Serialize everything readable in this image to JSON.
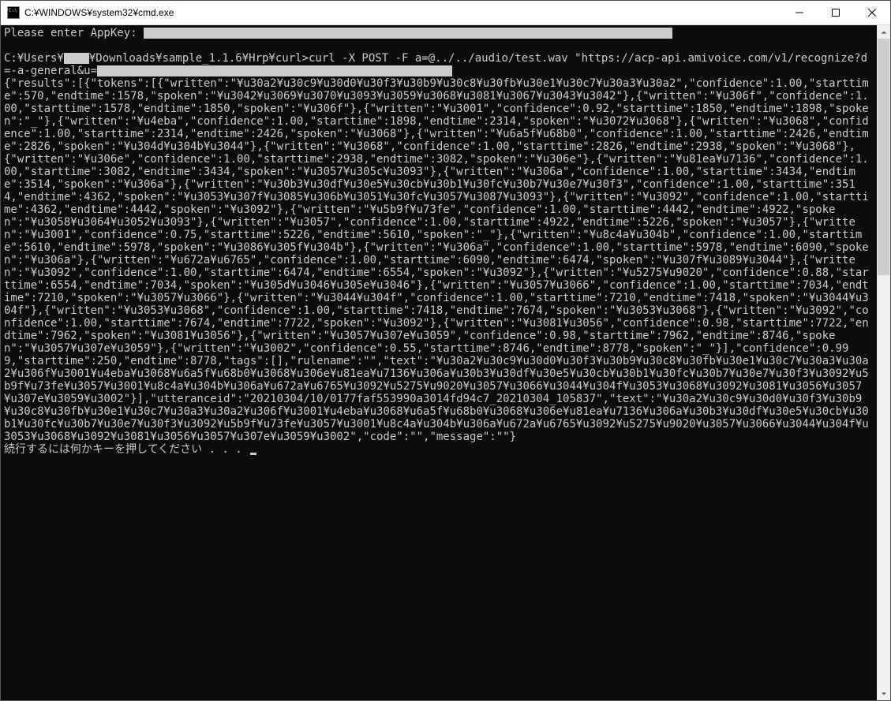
{
  "window": {
    "title": "C:¥WINDOWS¥system32¥cmd.exe"
  },
  "console": {
    "prompt_appkey": "Please enter AppKey: ",
    "redact1_width": 670,
    "blank1": "",
    "line_cmd1": "C:¥Users¥",
    "redact_user_width": 32,
    "line_cmd2": "¥Downloads¥sample_1.1.6¥Hrp¥curl>curl -X POST -F a=@../../audio/test.wav \"https://acp-api.amivoice.com/v1/recognize?d=-a-general&u=",
    "redact2_width": 450,
    "json_body": "{\"results\":[{\"tokens\":[{\"written\":\"¥u30a2¥u30c9¥u30d0¥u30f3¥u30b9¥u30c8¥u30fb¥u30e1¥u30c7¥u30a3¥u30a2\",\"confidence\":1.00,\"starttime\":570,\"endtime\":1578,\"spoken\":\"¥u3042¥u3069¥u3070¥u3093¥u3059¥u3068¥u3081¥u3067¥u3043¥u3042\"},{\"written\":\"¥u306f\",\"confidence\":1.00,\"starttime\":1578,\"endtime\":1850,\"spoken\":\"¥u306f\"},{\"written\":\"¥u3001\",\"confidence\":0.92,\"starttime\":1850,\"endtime\":1898,\"spoken\":\"_\"},{\"written\":\"¥u4eba\",\"confidence\":1.00,\"starttime\":1898,\"endtime\":2314,\"spoken\":\"¥u3072¥u3068\"},{\"written\":\"¥u3068\",\"confidence\":1.00,\"starttime\":2314,\"endtime\":2426,\"spoken\":\"¥u3068\"},{\"written\":\"¥u6a5f¥u68b0\",\"confidence\":1.00,\"starttime\":2426,\"endtime\":2826,\"spoken\":\"¥u304d¥u304b¥u3044\"},{\"written\":\"¥u3068\",\"confidence\":1.00,\"starttime\":2826,\"endtime\":2938,\"spoken\":\"¥u3068\"},{\"written\":\"¥u306e\",\"confidence\":1.00,\"starttime\":2938,\"endtime\":3082,\"spoken\":\"¥u306e\"},{\"written\":\"¥u81ea¥u7136\",\"confidence\":1.00,\"starttime\":3082,\"endtime\":3434,\"spoken\":\"¥u3057¥u305c¥u3093\"},{\"written\":\"¥u306a\",\"confidence\":1.00,\"starttime\":3434,\"endtime\":3514,\"spoken\":\"¥u306a\"},{\"written\":\"¥u30b3¥u30df¥u30e5¥u30cb¥u30b1¥u30fc¥u30b7¥u30e7¥u30f3\",\"confidence\":1.00,\"starttime\":3514,\"endtime\":4362,\"spoken\":\"¥u3053¥u307f¥u3085¥u306b¥u3051¥u30fc¥u3057¥u3087¥u3093\"},{\"written\":\"¥u3092\",\"confidence\":1.00,\"starttime\":4362,\"endtime\":4442,\"spoken\":\"¥u3092\"},{\"written\":\"¥u5b9f¥u73fe\",\"confidence\":1.00,\"starttime\":4442,\"endtime\":4922,\"spoken\":\"¥u3058¥u3064¥u3052¥u3093\"},{\"written\":\"¥u3057\",\"confidence\":1.00,\"starttime\":4922,\"endtime\":5226,\"spoken\":\"¥u3057\"},{\"written\":\"¥u3001\",\"confidence\":0.75,\"starttime\":5226,\"endtime\":5610,\"spoken\":\"_\"},{\"written\":\"¥u8c4a¥u304b\",\"confidence\":1.00,\"starttime\":5610,\"endtime\":5978,\"spoken\":\"¥u3086¥u305f¥u304b\"},{\"written\":\"¥u306a\",\"confidence\":1.00,\"starttime\":5978,\"endtime\":6090,\"spoken\":\"¥u306a\"},{\"written\":\"¥u672a¥u6765\",\"confidence\":1.00,\"starttime\":6090,\"endtime\":6474,\"spoken\":\"¥u307f¥u3089¥u3044\"},{\"written\":\"¥u3092\",\"confidence\":1.00,\"starttime\":6474,\"endtime\":6554,\"spoken\":\"¥u3092\"},{\"written\":\"¥u5275¥u9020\",\"confidence\":0.88,\"starttime\":6554,\"endtime\":7034,\"spoken\":\"¥u305d¥u3046¥u305e¥u3046\"},{\"written\":\"¥u3057¥u3066\",\"confidence\":1.00,\"starttime\":7034,\"endtime\":7210,\"spoken\":\"¥u3057¥u3066\"},{\"written\":\"¥u3044¥u304f\",\"confidence\":1.00,\"starttime\":7210,\"endtime\":7418,\"spoken\":\"¥u3044¥u304f\"},{\"written\":\"¥u3053¥u3068\",\"confidence\":1.00,\"starttime\":7418,\"endtime\":7674,\"spoken\":\"¥u3053¥u3068\"},{\"written\":\"¥u3092\",\"confidence\":1.00,\"starttime\":7674,\"endtime\":7722,\"spoken\":\"¥u3092\"},{\"written\":\"¥u3081¥u3056\",\"confidence\":0.98,\"starttime\":7722,\"endtime\":7962,\"spoken\":\"¥u3081¥u3056\"},{\"written\":\"¥u3057¥u307e¥u3059\",\"confidence\":0.98,\"starttime\":7962,\"endtime\":8746,\"spoken\":\"¥u3057¥u307e¥u3059\"},{\"written\":\"¥u3002\",\"confidence\":0.55,\"starttime\":8746,\"endtime\":8778,\"spoken\":\"_\"}],\"confidence\":0.999,\"starttime\":250,\"endtime\":8778,\"tags\":[],\"rulename\":\"\",\"text\":\"¥u30a2¥u30c9¥u30d0¥u30f3¥u30b9¥u30c8¥u30fb¥u30e1¥u30c7¥u30a3¥u30a2¥u306f¥u3001¥u4eba¥u3068¥u6a5f¥u68b0¥u3068¥u306e¥u81ea¥u7136¥u306a¥u30b3¥u30df¥u30e5¥u30cb¥u30b1¥u30fc¥u30b7¥u30e7¥u30f3¥u3092¥u5b9f¥u73fe¥u3057¥u3001¥u8c4a¥u304b¥u306a¥u672a¥u6765¥u3092¥u5275¥u9020¥u3057¥u3066¥u3044¥u304f¥u3053¥u3068¥u3092¥u3081¥u3056¥u3057¥u307e¥u3059¥u3002\"}],\"utteranceid\":\"20210304/10/0177faf553990a3014fd94c7_20210304_105837\",\"text\":\"¥u30a2¥u30c9¥u30d0¥u30f3¥u30b9¥u30c8¥u30fb¥u30e1¥u30c7¥u30a3¥u30a2¥u306f¥u3001¥u4eba¥u3068¥u6a5f¥u68b0¥u3068¥u306e¥u81ea¥u7136¥u306a¥u30b3¥u30df¥u30e5¥u30cb¥u30b1¥u30fc¥u30b7¥u30e7¥u30f3¥u3092¥u5b9f¥u73fe¥u3057¥u3001¥u8c4a¥u304b¥u306a¥u672a¥u6765¥u3092¥u5275¥u9020¥u3057¥u3066¥u3044¥u304f¥u3053¥u3068¥u3092¥u3081¥u3056¥u3057¥u307e¥u3059¥u3002\",\"code\":\"\",\"message\":\"\"}",
    "continue_prompt": "続行するには何かキーを押してください . . . "
  }
}
